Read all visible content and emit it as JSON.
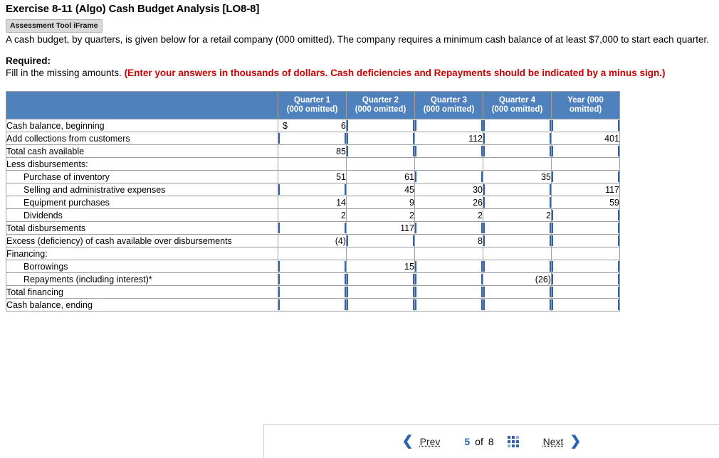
{
  "exercise": {
    "title": "Exercise 8-11 (Algo) Cash Budget Analysis [LO8-8]",
    "badge": "Assessment Tool iFrame",
    "intro": "A cash budget, by quarters, is given below for a retail company (000 omitted). The company requires a minimum cash balance of at least $7,000 to start each quarter.",
    "required_label": "Required:",
    "required_text": "Fill in the missing amounts.",
    "required_note": "(Enter your answers in thousands of dollars. Cash deficiencies and Repayments should be indicated by a minus sign.)"
  },
  "table": {
    "headers": [
      "",
      "Quarter 1\n(000 omitted)",
      "Quarter 2\n(000 omitted)",
      "Quarter 3\n(000 omitted)",
      "Quarter 4\n(000 omitted)",
      "Year (000\nomitted)"
    ],
    "header_lines": [
      [
        "",
        ""
      ],
      [
        "Quarter 1",
        "(000 omitted)"
      ],
      [
        "Quarter 2",
        "(000 omitted)"
      ],
      [
        "Quarter 3",
        "(000 omitted)"
      ],
      [
        "Quarter 4",
        "(000 omitted)"
      ],
      [
        "Year (000",
        "omitted)"
      ]
    ],
    "rows": [
      {
        "label": "Cash balance, beginning",
        "indent": 0,
        "cells": [
          {
            "value": "6",
            "input": false,
            "dollar": true
          },
          {
            "value": "",
            "input": true
          },
          {
            "value": "",
            "input": true
          },
          {
            "value": "",
            "input": true
          },
          {
            "value": "",
            "input": true
          }
        ]
      },
      {
        "label": "Add collections from customers",
        "indent": 0,
        "cells": [
          {
            "value": "",
            "input": true
          },
          {
            "value": "",
            "input": true
          },
          {
            "value": "112",
            "input": false
          },
          {
            "value": "",
            "input": true
          },
          {
            "value": "401",
            "input": false
          }
        ]
      },
      {
        "label": "Total cash available",
        "indent": 0,
        "cells": [
          {
            "value": "85",
            "input": false
          },
          {
            "value": "",
            "input": true
          },
          {
            "value": "",
            "input": true
          },
          {
            "value": "",
            "input": true
          },
          {
            "value": "",
            "input": true
          }
        ]
      },
      {
        "label": "Less disbursements:",
        "indent": 0,
        "cells": [
          {
            "value": "",
            "input": false
          },
          {
            "value": "",
            "input": false
          },
          {
            "value": "",
            "input": false
          },
          {
            "value": "",
            "input": false
          },
          {
            "value": "",
            "input": false
          }
        ]
      },
      {
        "label": "Purchase of inventory",
        "indent": 1,
        "cells": [
          {
            "value": "51",
            "input": false
          },
          {
            "value": "61",
            "input": false
          },
          {
            "value": "",
            "input": true
          },
          {
            "value": "35",
            "input": false
          },
          {
            "value": "",
            "input": true
          }
        ]
      },
      {
        "label": "Selling and administrative expenses",
        "indent": 1,
        "cells": [
          {
            "value": "",
            "input": true
          },
          {
            "value": "45",
            "input": false
          },
          {
            "value": "30",
            "input": false
          },
          {
            "value": "",
            "input": true
          },
          {
            "value": "117",
            "input": false
          }
        ]
      },
      {
        "label": "Equipment purchases",
        "indent": 1,
        "cells": [
          {
            "value": "14",
            "input": false
          },
          {
            "value": "9",
            "input": false
          },
          {
            "value": "26",
            "input": false
          },
          {
            "value": "",
            "input": true
          },
          {
            "value": "59",
            "input": false
          }
        ]
      },
      {
        "label": "Dividends",
        "indent": 1,
        "cells": [
          {
            "value": "2",
            "input": false
          },
          {
            "value": "2",
            "input": false
          },
          {
            "value": "2",
            "input": false
          },
          {
            "value": "2",
            "input": false
          },
          {
            "value": "",
            "input": true
          }
        ]
      },
      {
        "label": "Total disbursements",
        "indent": 0,
        "cells": [
          {
            "value": "",
            "input": true
          },
          {
            "value": "117",
            "input": false
          },
          {
            "value": "",
            "input": true
          },
          {
            "value": "",
            "input": true
          },
          {
            "value": "",
            "input": true
          }
        ]
      },
      {
        "label": "Excess (deficiency) of cash available over disbursements",
        "indent": 0,
        "cells": [
          {
            "value": "(4)",
            "input": false
          },
          {
            "value": "",
            "input": true
          },
          {
            "value": "8",
            "input": false
          },
          {
            "value": "",
            "input": true
          },
          {
            "value": "",
            "input": true
          }
        ]
      },
      {
        "label": "Financing:",
        "indent": 0,
        "cells": [
          {
            "value": "",
            "input": false
          },
          {
            "value": "",
            "input": false
          },
          {
            "value": "",
            "input": false
          },
          {
            "value": "",
            "input": false
          },
          {
            "value": "",
            "input": false
          }
        ]
      },
      {
        "label": "Borrowings",
        "indent": 1,
        "cells": [
          {
            "value": "",
            "input": true
          },
          {
            "value": "15",
            "input": false
          },
          {
            "value": "",
            "input": true
          },
          {
            "value": "",
            "input": true
          },
          {
            "value": "",
            "input": true
          }
        ]
      },
      {
        "label": "Repayments (including interest)*",
        "indent": 1,
        "cells": [
          {
            "value": "",
            "input": true
          },
          {
            "value": "",
            "input": true
          },
          {
            "value": "",
            "input": true
          },
          {
            "value": "(26)",
            "input": false
          },
          {
            "value": "",
            "input": true
          }
        ]
      },
      {
        "label": "Total financing",
        "indent": 0,
        "cells": [
          {
            "value": "",
            "input": true
          },
          {
            "value": "",
            "input": true
          },
          {
            "value": "",
            "input": true
          },
          {
            "value": "",
            "input": true
          },
          {
            "value": "",
            "input": true
          }
        ]
      },
      {
        "label": "Cash balance, ending",
        "indent": 0,
        "cells": [
          {
            "value": "",
            "input": true
          },
          {
            "value": "",
            "input": true
          },
          {
            "value": "",
            "input": true
          },
          {
            "value": "",
            "input": true
          },
          {
            "value": "",
            "input": true
          }
        ]
      }
    ]
  },
  "nav": {
    "prev_label": "Prev",
    "next_label": "Next",
    "page_current": "5",
    "page_of": "of",
    "page_total": "8",
    "prev_icon": "chevron-left-icon",
    "next_icon": "chevron-right-icon",
    "grid_icon": "grid-view-icon"
  },
  "colors": {
    "header_blue": "#4f81bd",
    "input_border": "#2f62b3",
    "alert_red": "#cc0000"
  }
}
